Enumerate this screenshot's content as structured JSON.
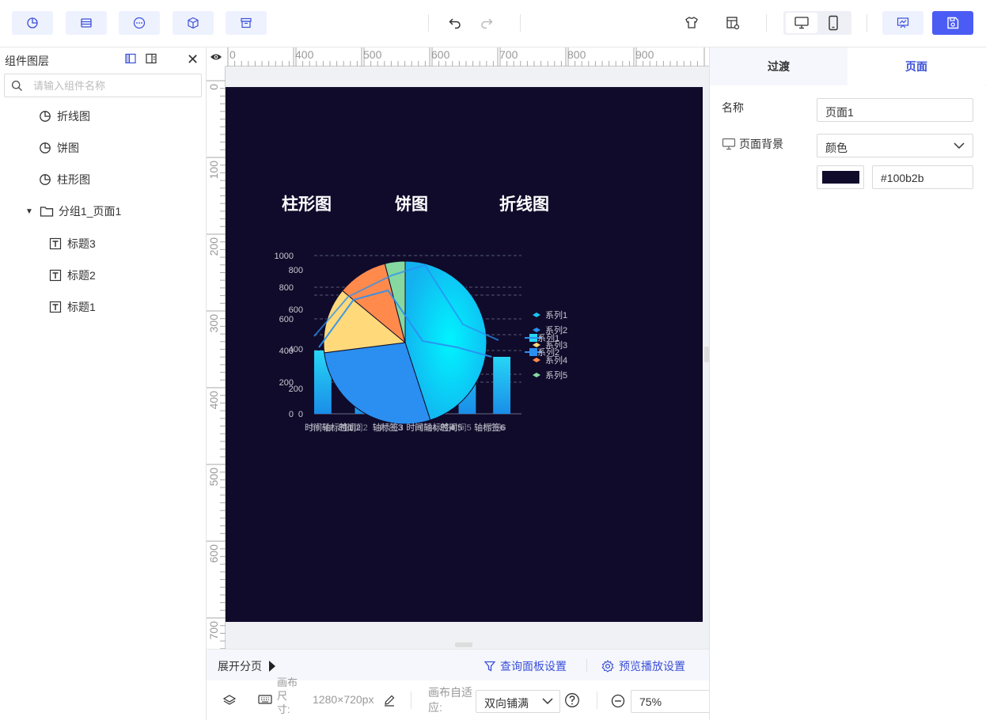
{
  "toolbar": {
    "left_buttons": [
      "chart-icon",
      "database-icon",
      "more-icon",
      "cube-icon",
      "archive-icon"
    ],
    "undo_icon": "undo-icon",
    "redo_icon": "redo-icon",
    "accent": "#4b5cf5"
  },
  "layers": {
    "title": "组件图层",
    "search_placeholder": "请输入组件名称",
    "items": [
      {
        "label": "折线图",
        "icon": "chart-pie-icon"
      },
      {
        "label": "饼图",
        "icon": "chart-pie-icon"
      },
      {
        "label": "柱形图",
        "icon": "chart-pie-icon"
      },
      {
        "label": "分组1_页面1",
        "icon": "folder-icon"
      },
      {
        "label": "标题3",
        "icon": "text-icon"
      },
      {
        "label": "标题2",
        "icon": "text-icon"
      },
      {
        "label": "标题1",
        "icon": "text-icon"
      }
    ]
  },
  "rulers": {
    "h_labels": [
      "0",
      "400",
      "500",
      "600",
      "700",
      "800",
      "900"
    ],
    "v_labels": [
      "0",
      "100",
      "200",
      "300",
      "400",
      "500",
      "600",
      "700"
    ]
  },
  "stage": {
    "background": "#100b2b",
    "titles": [
      "柱形图",
      "饼图",
      "折线图"
    ]
  },
  "chart_data": {
    "type": "bar",
    "categories": [
      "时间1",
      "时间2",
      "时间3",
      "时间4",
      "时间5",
      "时间6"
    ],
    "y_ticks_left": [
      "0",
      "200",
      "400",
      "600",
      "800",
      "1000"
    ],
    "y_ticks_mid": [
      "0",
      "200",
      "400",
      "600",
      "800"
    ],
    "x_labels_overlap": [
      "时间轴标签1",
      "时间2",
      "轴标签3",
      "时间轴标签4",
      "时间5",
      "轴标签6"
    ],
    "bar_values": [
      400,
      120,
      260,
      180,
      460,
      360
    ],
    "line_values": [
      420,
      720,
      780,
      460,
      420,
      360
    ],
    "pie_slices": [
      {
        "name": "系列1",
        "value": 45,
        "color": "#19c6f0"
      },
      {
        "name": "系列2",
        "value": 28,
        "color": "#2a8ff0"
      },
      {
        "name": "系列3",
        "value": 13,
        "color": "#ffd97a"
      },
      {
        "name": "系列4",
        "value": 10,
        "color": "#ff8a4c"
      },
      {
        "name": "系列5",
        "value": 4,
        "color": "#86d8a0"
      }
    ],
    "legend": [
      "系列1",
      "系列2",
      "系列3",
      "系列4",
      "系列5"
    ],
    "legend_overlap": [
      "系列1",
      "系列2"
    ]
  },
  "page_bar": {
    "expand_label": "展开分页",
    "query_label": "查询面板设置",
    "preview_label": "预览播放设置"
  },
  "status": {
    "canvas_size_label": "画布尺寸:",
    "canvas_size": "1280×720px",
    "adapt_label": "画布自适应:",
    "adapt_value": "双向铺满",
    "zoom": "75%"
  },
  "right_panel": {
    "tab_transition": "过渡",
    "tab_page": "页面",
    "name_label": "名称",
    "name_value": "页面1",
    "bg_label": "页面背景",
    "bg_type": "颜色",
    "bg_color": "#100b2b"
  }
}
